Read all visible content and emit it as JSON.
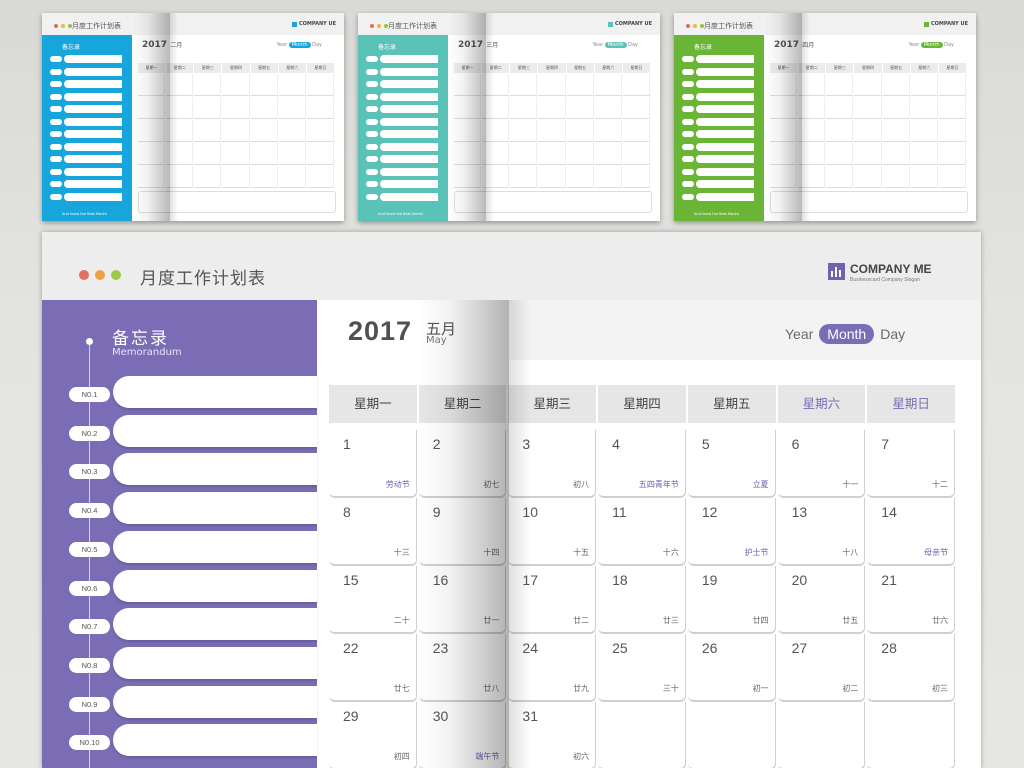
{
  "thumbnails": [
    {
      "accent": "#17a6dc",
      "title": "月度工作计划表",
      "company": "COMPANY UE",
      "memo": "备忘录",
      "year": "2017",
      "month": "二月",
      "year_label": "Year",
      "month_label": "Month",
      "day_label": "Day",
      "slogan": "And know the Best Month",
      "dots": [
        "#e06b5b",
        "#f0b53a",
        "#8cc63f"
      ]
    },
    {
      "accent": "#5bc2b8",
      "title": "月度工作计划表",
      "company": "COMPANY UE",
      "memo": "备忘录",
      "year": "2017",
      "month": "三月",
      "year_label": "Year",
      "month_label": "Month",
      "day_label": "Day",
      "slogan": "And know the Best Month",
      "dots": [
        "#e06b5b",
        "#f0b53a",
        "#8cc63f"
      ]
    },
    {
      "accent": "#6ab535",
      "title": "月度工作计划表",
      "company": "COMPANY UE",
      "memo": "备忘录",
      "year": "2017",
      "month": "四月",
      "year_label": "Year",
      "month_label": "Month",
      "day_label": "Day",
      "slogan": "And know the Best Month",
      "dots": [
        "#e06b5b",
        "#f0b53a",
        "#8cc63f"
      ]
    }
  ],
  "main": {
    "accent": "#7b6db5",
    "title": "月度工作计划表",
    "dots": [
      "#e07060",
      "#f0a040",
      "#9cc84a"
    ],
    "company": "COMPANY ME",
    "slogan": "Businesscard Company Slogan",
    "memo_cn": "备忘录",
    "memo_en": "Memorandum",
    "memo_items": [
      "N0.1",
      "N0.2",
      "N0.3",
      "N0.4",
      "N0.5",
      "N0.6",
      "N0.7",
      "N0.8",
      "N0.9",
      "N0.10"
    ],
    "year": "2017",
    "month_cn": "五月",
    "month_en": "May",
    "view": {
      "year": "Year",
      "month": "Month",
      "day": "Day",
      "active": "month"
    },
    "weekdays": [
      "星期一",
      "星期二",
      "星期三",
      "星期四",
      "星期五",
      "星期六",
      "星期日"
    ],
    "days": [
      {
        "n": "1",
        "l": "劳动节",
        "f": true
      },
      {
        "n": "2",
        "l": "初七"
      },
      {
        "n": "3",
        "l": "初八"
      },
      {
        "n": "4",
        "l": "五四青年节",
        "f": true
      },
      {
        "n": "5",
        "l": "立夏",
        "f": true
      },
      {
        "n": "6",
        "l": "十一"
      },
      {
        "n": "7",
        "l": "十二"
      },
      {
        "n": "8",
        "l": "十三"
      },
      {
        "n": "9",
        "l": "十四"
      },
      {
        "n": "10",
        "l": "十五"
      },
      {
        "n": "11",
        "l": "十六"
      },
      {
        "n": "12",
        "l": "护士节",
        "f": true
      },
      {
        "n": "13",
        "l": "十八"
      },
      {
        "n": "14",
        "l": "母亲节",
        "f": true
      },
      {
        "n": "15",
        "l": "二十"
      },
      {
        "n": "16",
        "l": "廿一"
      },
      {
        "n": "17",
        "l": "廿二"
      },
      {
        "n": "18",
        "l": "廿三"
      },
      {
        "n": "19",
        "l": "廿四"
      },
      {
        "n": "20",
        "l": "廿五"
      },
      {
        "n": "21",
        "l": "廿六"
      },
      {
        "n": "22",
        "l": "廿七"
      },
      {
        "n": "23",
        "l": "廿八"
      },
      {
        "n": "24",
        "l": "廿九"
      },
      {
        "n": "25",
        "l": "三十"
      },
      {
        "n": "26",
        "l": "初一"
      },
      {
        "n": "27",
        "l": "初二"
      },
      {
        "n": "28",
        "l": "初三"
      },
      {
        "n": "29",
        "l": "初四"
      },
      {
        "n": "30",
        "l": "端午节",
        "f": true
      },
      {
        "n": "31",
        "l": "初六"
      },
      {
        "n": "",
        "l": ""
      },
      {
        "n": "",
        "l": ""
      },
      {
        "n": "",
        "l": ""
      },
      {
        "n": "",
        "l": ""
      }
    ]
  }
}
